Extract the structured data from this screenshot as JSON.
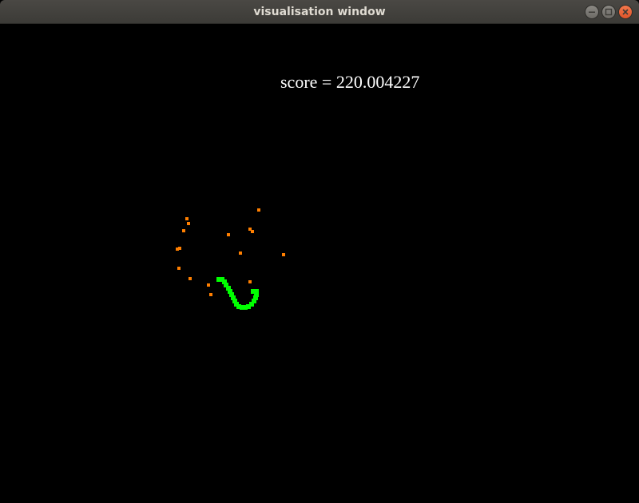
{
  "window": {
    "title": "visualisation window",
    "controls": [
      "minimize-icon",
      "maximize-icon",
      "close-icon"
    ]
  },
  "game": {
    "score_text": "score = 220.004227",
    "colors": {
      "background": "#000000",
      "food": "#ff7f00",
      "snake": "#00ff00",
      "text": "#ffffff"
    }
  }
}
